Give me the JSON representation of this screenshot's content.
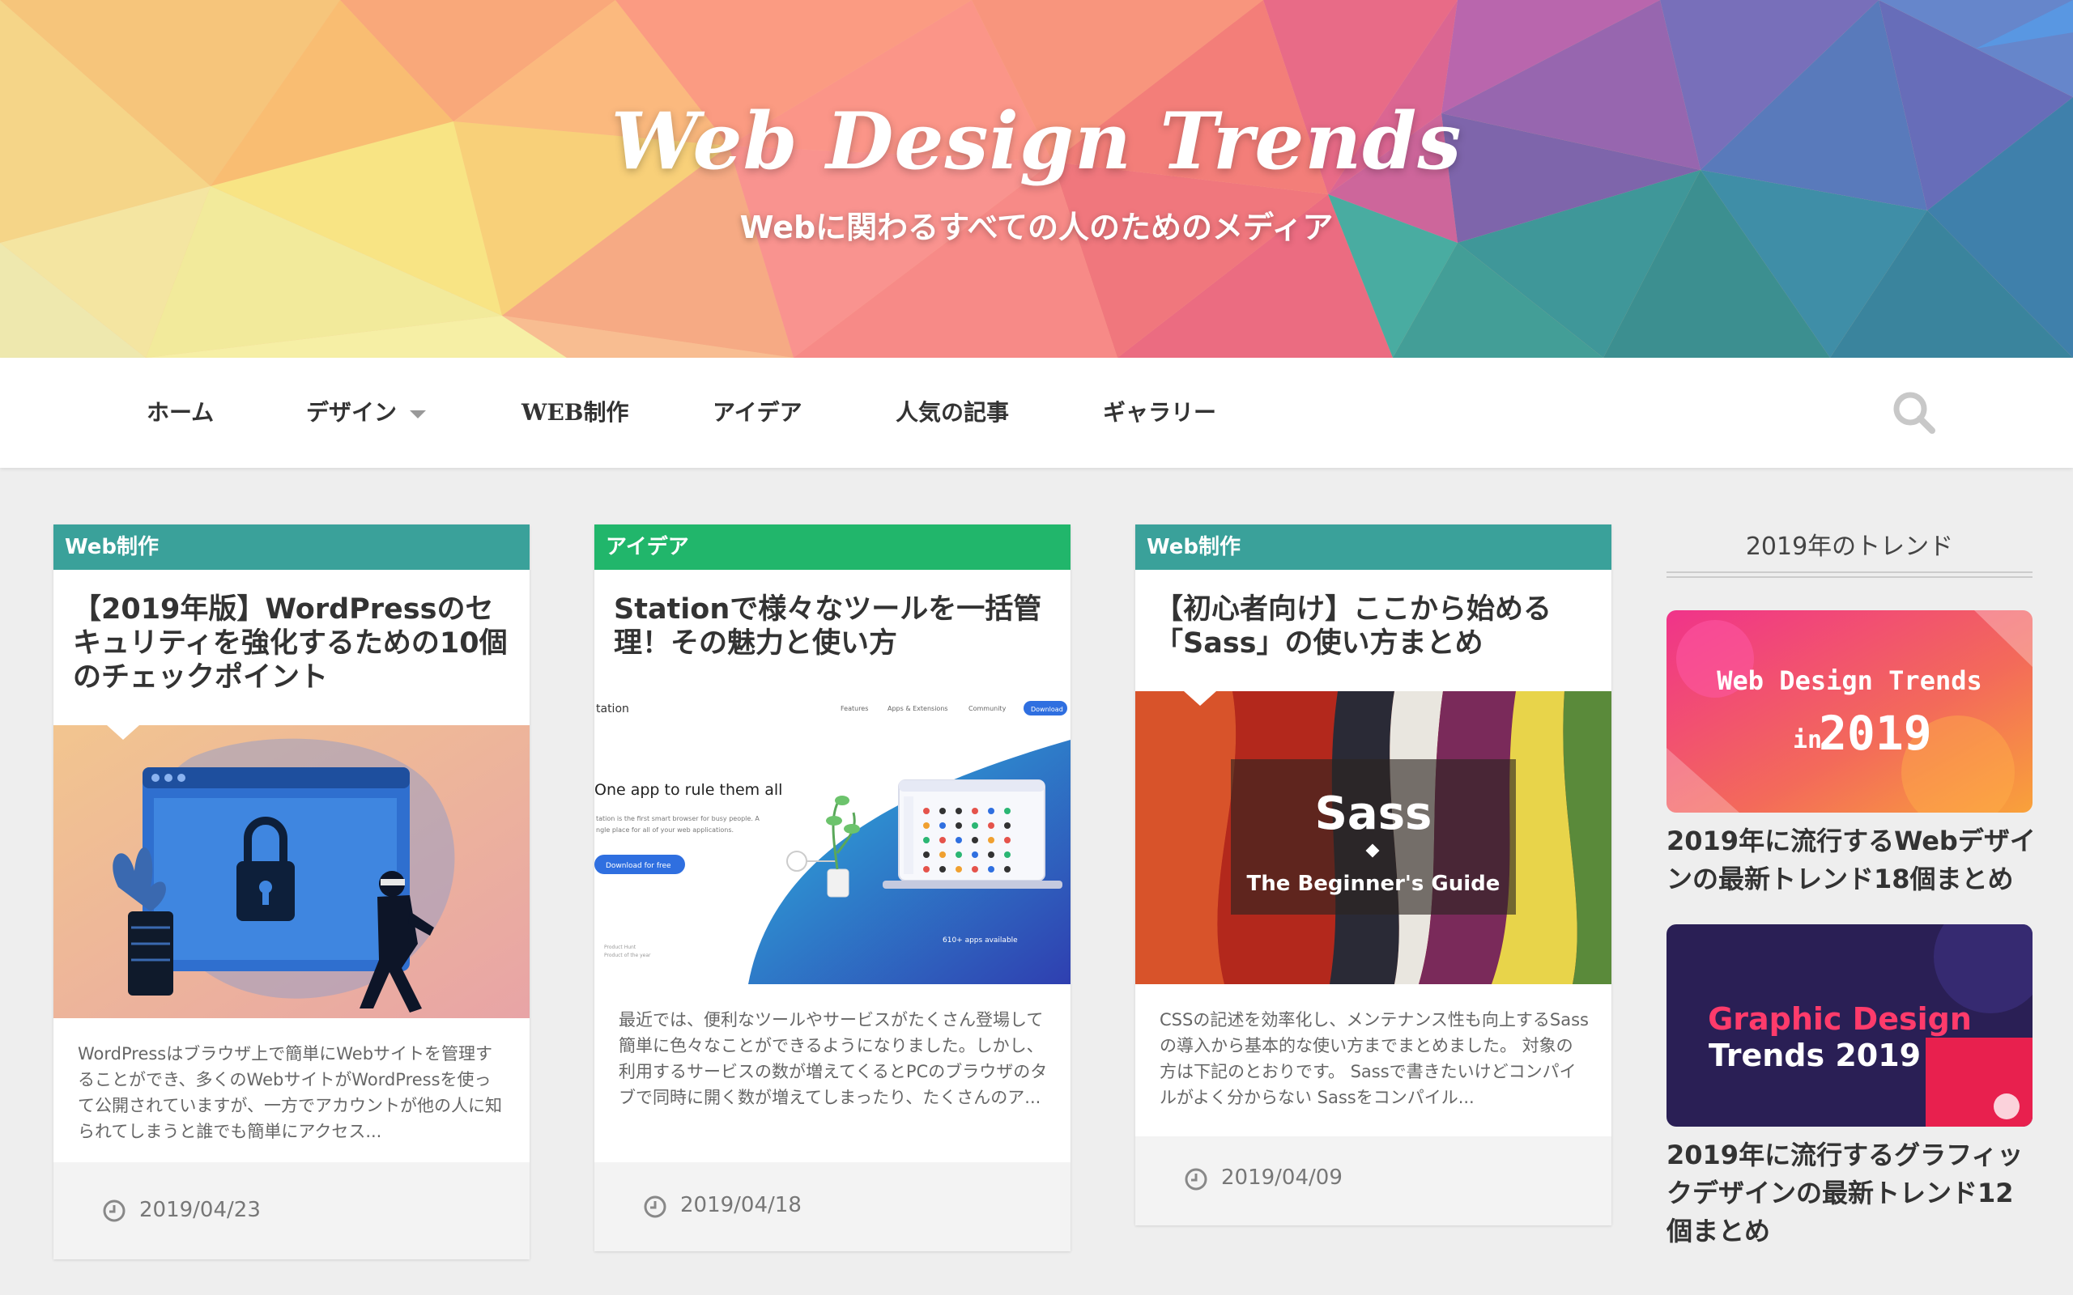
{
  "site": {
    "title": "Web Design Trends",
    "tagline": "Webに関わるすべての人のためのメディア"
  },
  "nav": {
    "items": [
      {
        "label": "ホーム"
      },
      {
        "label": "デザイン",
        "has_dropdown": true
      },
      {
        "label": "WEB制作"
      },
      {
        "label": "アイデア"
      },
      {
        "label": "人気の記事"
      },
      {
        "label": "ギャラリー"
      }
    ],
    "search_icon": "search-icon"
  },
  "colors": {
    "cat_web": "#3aa19a",
    "cat_idea": "#21b66b",
    "background": "#eeeeee"
  },
  "posts": [
    {
      "category": "Web制作",
      "title": "【2019年版】WordPressのセキュリティを強化するための10個のチェックポイント",
      "excerpt": "WordPressはブラウザ上で簡単にWebサイトを管理することができ、多くのWebサイトがWordPressを使って公開されていますが、一方でアカウントが他の人に知られてしまうと誰でも簡単にアクセス...",
      "date": "2019/04/23"
    },
    {
      "category": "アイデア",
      "title": "Stationで様々なツールを一括管理！その魅力と使い方",
      "excerpt": "最近では、便利なツールやサービスがたくさん登場して簡単に色々なことができるようになりました。しかし、利用するサービスの数が増えてくるとPCのブラウザのタブで同時に開く数が増えてしまったり、たくさんのア...",
      "date": "2019/04/18",
      "thumb": {
        "logo": "tation",
        "nav_links": [
          "Features",
          "Apps & Extensions",
          "Community"
        ],
        "download": "Download",
        "headline": "One app to rule them all",
        "sub1": "tation is the first smart browser for busy people. A",
        "sub2": "ngle place for all of your web applications.",
        "cta": "Download for free",
        "badge1": "Product Hunt",
        "badge2": "Product of the year",
        "apps_count": "610+ apps available"
      }
    },
    {
      "category": "Web制作",
      "title": "【初心者向け】ここから始める「Sass」の使い方まとめ",
      "excerpt": "CSSの記述を効率化し、メンテナンス性も向上するSassの導入から基本的な使い方までまとめました。 対象の方は下記のとおりです。 Sassで書きたいけどコンパイルがよく分からない Sassをコンパイル...",
      "date": "2019/04/09",
      "thumb": {
        "title": "Sass",
        "subtitle": "The Beginner's Guide"
      }
    }
  ],
  "sidebar": {
    "heading": "2019年のトレンド",
    "items": [
      {
        "title": "2019年に流行するWebデザインの最新トレンド18個まとめ",
        "thumb": {
          "line1": "Web Design Trends",
          "line2a": "in",
          "line2b": "2019"
        }
      },
      {
        "title": "2019年に流行するグラフィックデザインの最新トレンド12個まとめ",
        "thumb": {
          "line1": "Graphic Design",
          "line2": "Trends 2019"
        }
      }
    ]
  }
}
